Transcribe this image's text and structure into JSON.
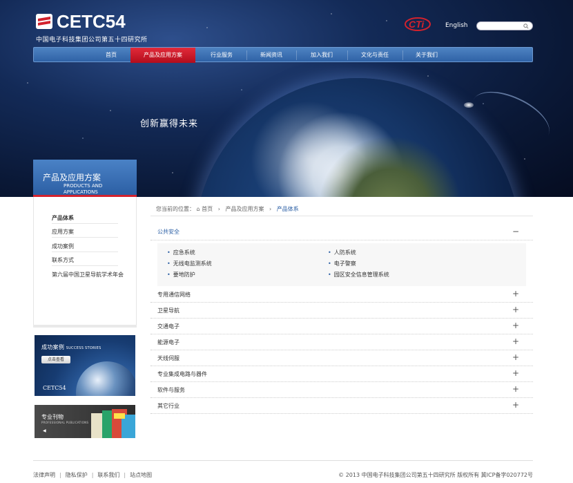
{
  "header": {
    "logo_text": "CETC54",
    "logo_subtitle": "中国电子科技集团公司第五十四研究所",
    "cti_logo": "CTi",
    "language_link": "English",
    "search_placeholder": ""
  },
  "nav": {
    "items": [
      {
        "label": "首页",
        "active": false
      },
      {
        "label": "产品及应用方案",
        "active": true
      },
      {
        "label": "行业服务",
        "active": false
      },
      {
        "label": "新闻资讯",
        "active": false
      },
      {
        "label": "加入我们",
        "active": false
      },
      {
        "label": "文化与责任",
        "active": false
      },
      {
        "label": "关于我们",
        "active": false
      }
    ]
  },
  "hero": {
    "slogan": "创新赢得未来"
  },
  "category": {
    "title_cn": "产品及应用方案",
    "title_en_line1": "PRODUCTS AND",
    "title_en_line2": "APPLICATIONS"
  },
  "sidebar": {
    "items": [
      {
        "label": "产品体系",
        "active": true
      },
      {
        "label": "应用方案",
        "active": false
      },
      {
        "label": "成功案例",
        "active": false
      },
      {
        "label": "联系方式",
        "active": false
      },
      {
        "label": "第六届中国卫星导航学术年会",
        "active": false
      }
    ]
  },
  "banners": {
    "success": {
      "title": "成功案例",
      "title_en": "SUCCESS STORIES",
      "button": "点击查看",
      "brand": "CETC54"
    },
    "journal": {
      "title": "专业刊物",
      "title_en": "PROFESSIONAL PUBLICATIONS",
      "arrow": "◀"
    }
  },
  "breadcrumb": {
    "prefix": "您当前的位置：",
    "home": "首页",
    "level1": "产品及应用方案",
    "current": "产品体系",
    "sep": "›"
  },
  "accordion": {
    "open": {
      "title": "公共安全",
      "toggle": "−",
      "items_left": [
        "应急系统",
        "无线电监测系统",
        "要地防护"
      ],
      "items_right": [
        "人防系统",
        "电子警察",
        "园区安全信息管理系统"
      ]
    },
    "closed": [
      {
        "title": "专用通信网络",
        "toggle": "+"
      },
      {
        "title": "卫星导航",
        "toggle": "+"
      },
      {
        "title": "交通电子",
        "toggle": "+"
      },
      {
        "title": "能源电子",
        "toggle": "+"
      },
      {
        "title": "天线伺服",
        "toggle": "+"
      },
      {
        "title": "专业集成电路与器件",
        "toggle": "+"
      },
      {
        "title": "软件与服务",
        "toggle": "+"
      },
      {
        "title": "其它行业",
        "toggle": "+"
      }
    ]
  },
  "footer": {
    "links": [
      "法律声明",
      "隐私保护",
      "联系我们",
      "站点地图"
    ],
    "link_sep": "|",
    "copyright": "© 2013 中国电子科技集团公司第五十四研究所 版权所有 冀ICP备字020772号"
  },
  "colors": {
    "nav_blue": "#2f62a6",
    "active_red": "#c8141f",
    "link_blue": "#2a5ea4"
  }
}
